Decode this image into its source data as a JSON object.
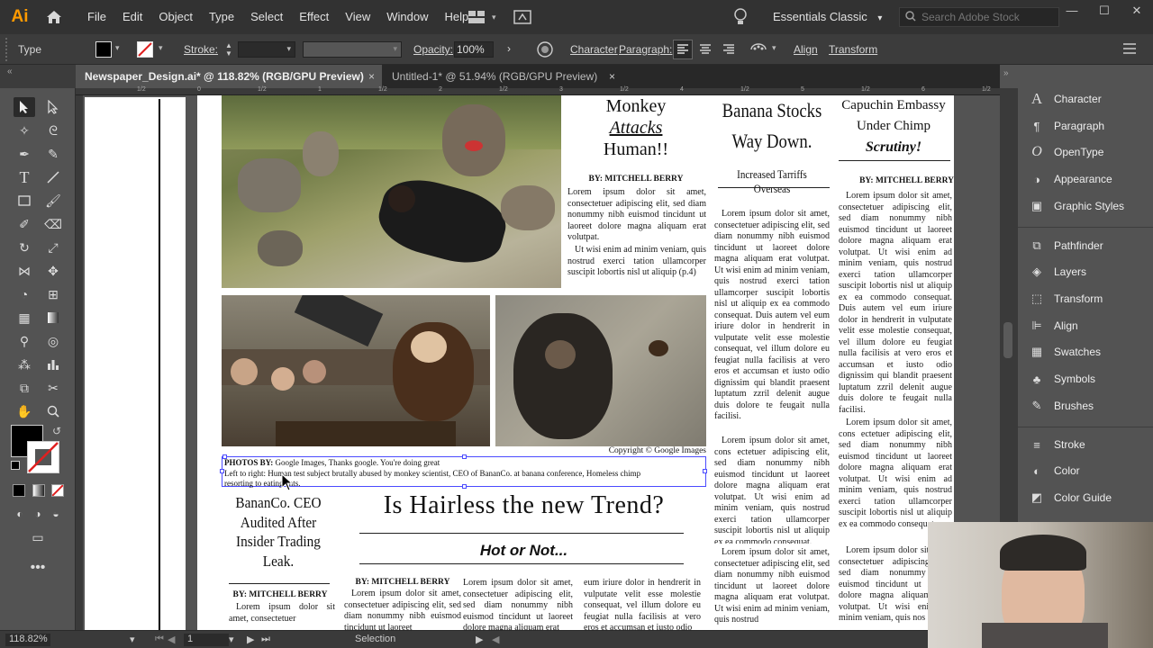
{
  "menubar": {
    "logo": "Ai",
    "items": [
      "File",
      "Edit",
      "Object",
      "Type",
      "Select",
      "Effect",
      "View",
      "Window",
      "Help"
    ],
    "workspace": "Essentials Classic",
    "search_placeholder": "Search Adobe Stock"
  },
  "control": {
    "tool_label": "Type",
    "stroke_label": "Stroke:",
    "opacity_label": "Opacity:",
    "opacity_value": "100%",
    "character": "Character",
    "paragraph": "Paragraph:",
    "align": "Align",
    "transform": "Transform"
  },
  "tabs": [
    {
      "label": "Newspaper_Design.ai* @ 118.82% (RGB/GPU Preview)",
      "close": "×"
    },
    {
      "label": "Untitled-1* @ 51.94% (RGB/GPU Preview)",
      "close": "×"
    }
  ],
  "ruler": {
    "marks": [
      "1/2",
      "0",
      "1/2",
      "1",
      "1/2",
      "2",
      "1/2",
      "3",
      "1/2",
      "4",
      "1/2",
      "5",
      "1/2",
      "6",
      "1/2"
    ]
  },
  "newspaper": {
    "col1_head": [
      "Monkey",
      "Attacks",
      "Human!!"
    ],
    "col1_byline": "BY: MITCHELL BERRY",
    "col1_p1": "Lorem ipsum dolor sit amet, consectetuer adipiscing elit, sed diam nonummy nibh euismod tincidunt ut laoreet dolore magna aliquam erat volutpat.",
    "col1_p2": "Ut wisi enim ad minim veniam, quis nostrud exerci tation ullamcorper suscipit lobortis nisl ut aliquip (p.4)",
    "col2_head": [
      "Banana Stocks",
      "Way Down."
    ],
    "col2_sub": "Increased Tarriffs Overseas",
    "col2_p": "Lorem ipsum dolor sit amet, consectetuer adipiscing elit, sed diam nonummy nibh euismod tincidunt ut laoreet dolore magna aliquam erat volutpat. Ut wisi enim ad minim veniam, quis nostrud exerci tation ullamcorper suscipit lobortis nisl ut aliquip ex ea commodo consequat. Duis autem vel eum iriure dolor in hendrerit in vulputate velit esse molestie consequat, vel illum dolore eu feugiat nulla facilisis at vero eros et accumsan et iusto odio dignissim qui blandit praesent luptatum zzril delenit augue duis dolore te feugait nulla facilisi.",
    "col2_p2": "Lorem ipsum dolor sit amet, cons ectetuer adipiscing elit, sed diam nonummy nibh euismod tincidunt ut laoreet dolore magna aliquam erat volutpat. Ut wisi enim ad minim veniam, quis nostrud exerci tation ullamcorper suscipit lobortis nisl ut aliquip ex ea commodo consequat.",
    "col2_p3": "Lorem ipsum dolor sit amet, consectetuer adipiscing elit, sed diam nonummy nibh euismod tincidunt ut laoreet dolore magna aliquam erat volutpat. Ut wisi enim ad minim veniam, quis nostrud",
    "col3_head": [
      "Capuchin Embassy",
      "Under Chimp",
      "Scrutiny!"
    ],
    "col3_byline": "BY: MITCHELL BERRY",
    "col3_p": "Lorem ipsum dolor sit amet, consectetuer adipiscing elit, sed diam nonummy nibh euismod tincidunt ut laoreet dolore magna aliquam erat volutpat. Ut wisi enim ad minim veniam, quis nostrud exerci tation ullamcorper suscipit lobortis nisl ut aliquip ex ea commodo consequat. Duis autem vel eum iriure dolor in hendrerit in vulputate velit esse molestie consequat, vel illum dolore eu feugiat nulla facilisis at vero eros et accumsan et iusto odio dignissim qui blandit praesent luptatum zzril delenit augue duis dolore te feugait nulla facilisi.",
    "col3_p2": "Lorem ipsum dolor sit amet, cons ectetuer adipiscing elit, sed diam nonummy nibh euismod tincidunt ut laoreet dolore magna aliquam erat volutpat. Ut wisi enim ad minim veniam, quis nostrud exerci tation ullamcorper suscipit lobortis nisl ut aliquip ex ea commodo consequat.",
    "col3_p3": "Lorem ipsum dolor sit amet, consectetuer adipiscing elit, sed diam nonummy nibh euismod tincidunt ut laoreet dolore magna aliquam erat volutpat. Ut wisi enim ad minim veniam, quis nos",
    "copyright": "Copyright © Google Images",
    "caption_bold": "PHOTOS BY:",
    "caption_1": " Google Images, Thanks google. You're doing great",
    "caption_2": "Left to right: Human test subject brutally abused by monkey scientist, CEO of BananCo. at banana conference, Homeless chimp",
    "caption_3": "resorting to eating ants.",
    "bottom_left_head": [
      "BananCo. CEO",
      "Audited After",
      "Insider Trading",
      "Leak."
    ],
    "bottom_left_byline": "BY: MITCHELL BERRY",
    "bottom_left_p": "Lorem ipsum dolor sit amet, consectetuer",
    "big_head": "Is Hairless the new Trend?",
    "big_sub": "Hot or Not...",
    "big_byline": "BY: MITCHELL BERRY",
    "big_c1": "Lorem ipsum dolor sit amet, consectetuer adipiscing elit, sed diam nonummy nibh euismod tincidunt ut laoreet",
    "big_c2": "Lorem ipsum dolor sit amet, consectetuer adipiscing elit, sed diam nonummy nibh euismod tincidunt ut laoreet dolore magna aliquam erat",
    "big_c3": "eum iriure dolor in hendrerit in vulputate velit esse molestie consequat, vel illum dolore eu feugiat nulla facilisis at vero eros et accumsan et iusto odio"
  },
  "panels": {
    "group1": [
      "Character",
      "Paragraph",
      "OpenType",
      "Appearance",
      "Graphic Styles"
    ],
    "group2": [
      "Pathfinder",
      "Layers",
      "Transform",
      "Align",
      "Swatches",
      "Symbols",
      "Brushes"
    ],
    "group3": [
      "Stroke",
      "Color",
      "Color Guide"
    ]
  },
  "status": {
    "zoom": "118.82%",
    "page": "1",
    "tool": "Selection"
  },
  "colors": {
    "accent": "#ff9a00",
    "selection": "#4b4bff"
  }
}
